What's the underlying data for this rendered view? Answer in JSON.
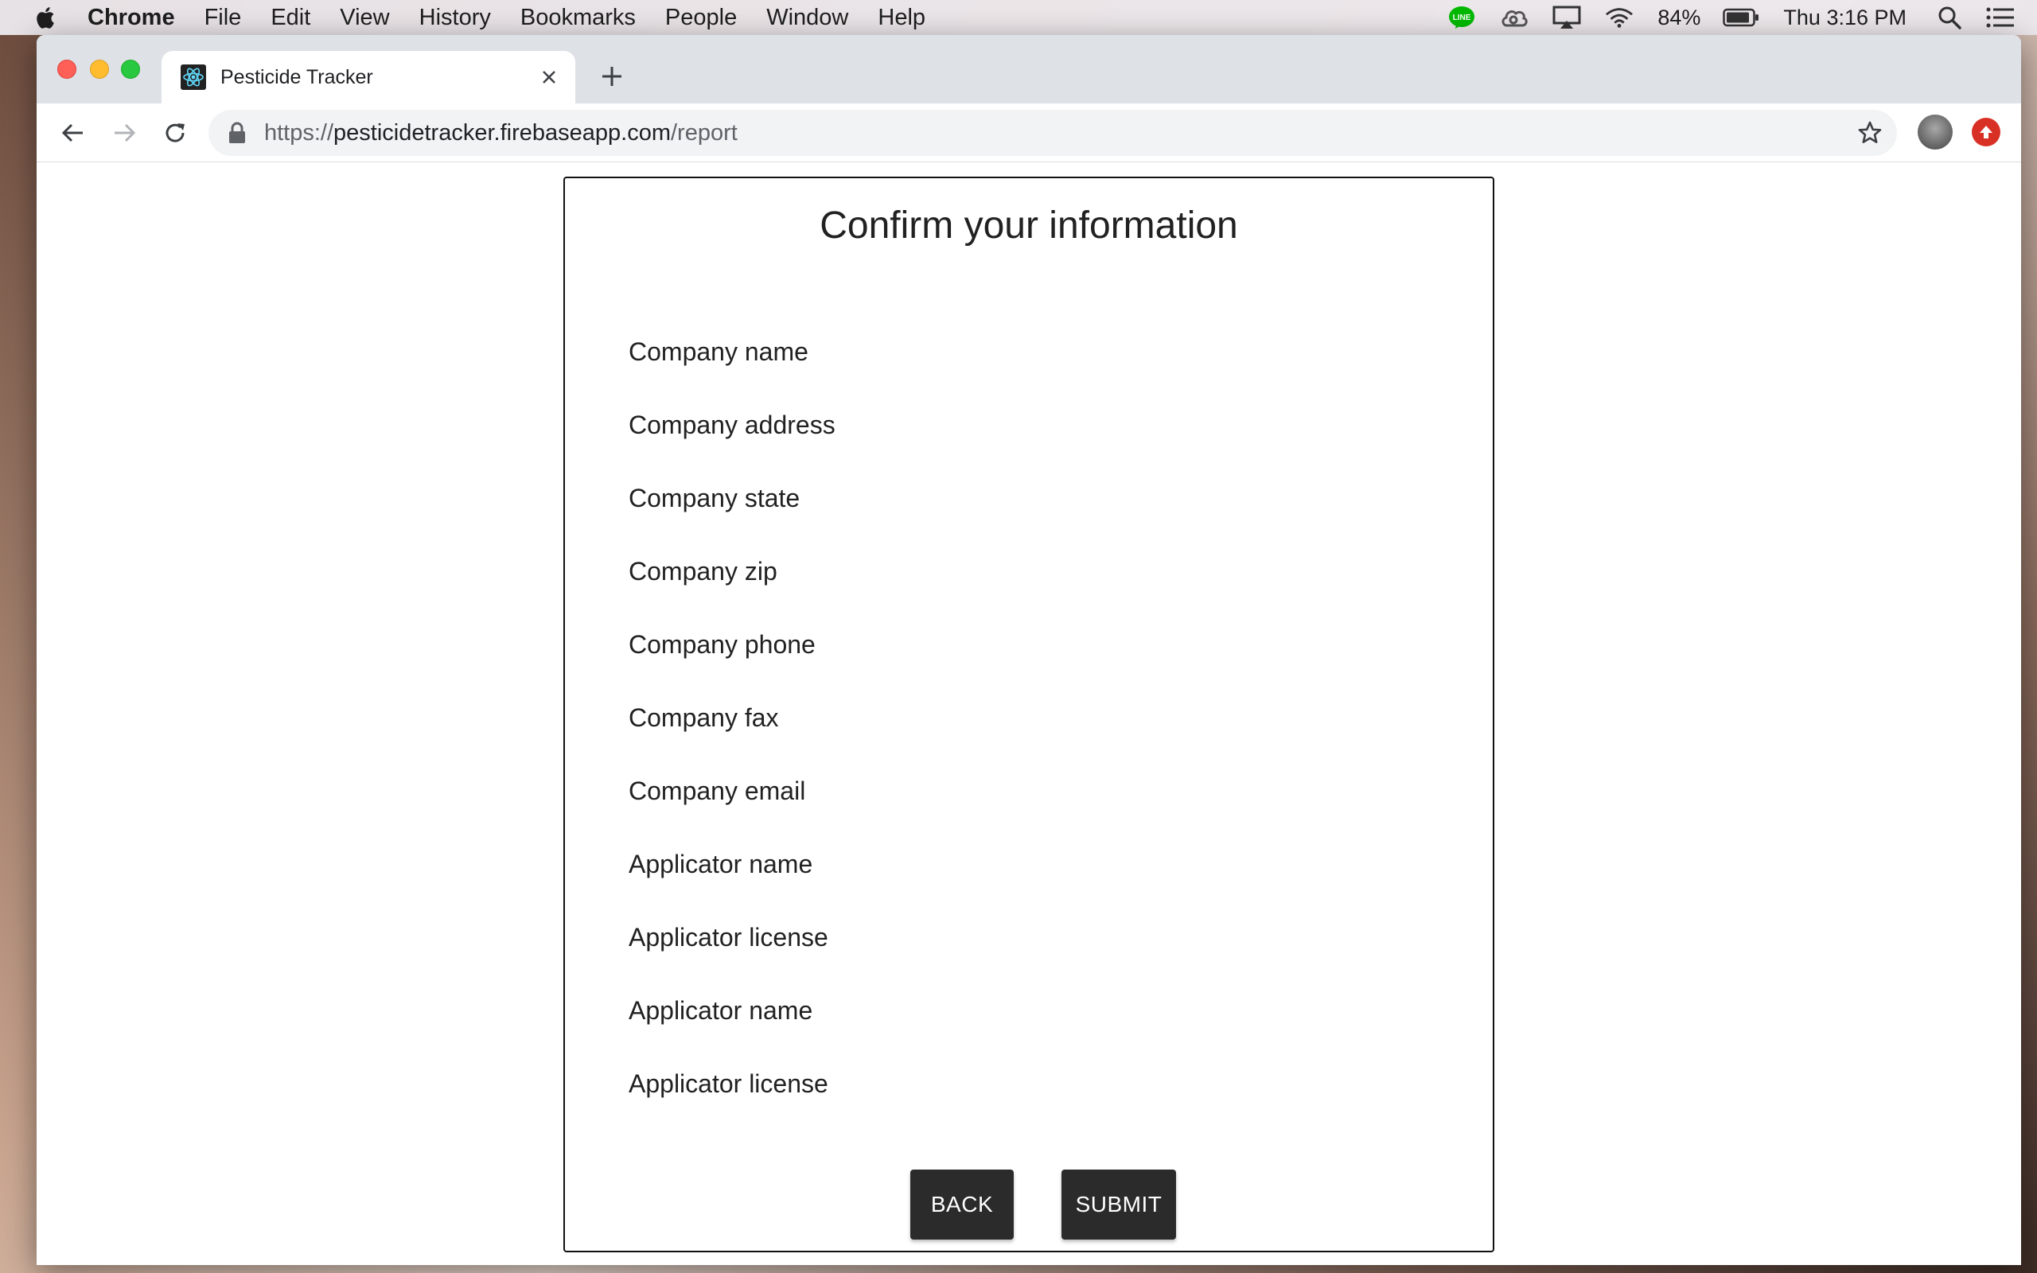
{
  "menubar": {
    "app_name": "Chrome",
    "items": [
      "File",
      "Edit",
      "View",
      "History",
      "Bookmarks",
      "People",
      "Window",
      "Help"
    ],
    "battery_percent": "84%",
    "clock": "Thu 3:16 PM",
    "status_icons": [
      "line-icon",
      "creative-cloud-icon",
      "airplay-icon",
      "wifi-icon",
      "battery-icon",
      "spotlight-icon",
      "notification-center-icon"
    ]
  },
  "browser": {
    "tab_title": "Pesticide Tracker",
    "url_scheme": "https://",
    "url_host": "pesticidetracker.firebaseapp.com",
    "url_path": "/report"
  },
  "page": {
    "title": "Confirm your information",
    "fields": [
      "Company name",
      "Company address",
      "Company state",
      "Company zip",
      "Company phone",
      "Company fax",
      "Company email",
      "Applicator name",
      "Applicator license",
      "Applicator name",
      "Applicator license"
    ],
    "back_label": "BACK",
    "submit_label": "SUBMIT"
  },
  "colors": {
    "button_bg": "#2b2b2b",
    "ext_icon": "#d93025",
    "line_icon": "#00b900"
  }
}
